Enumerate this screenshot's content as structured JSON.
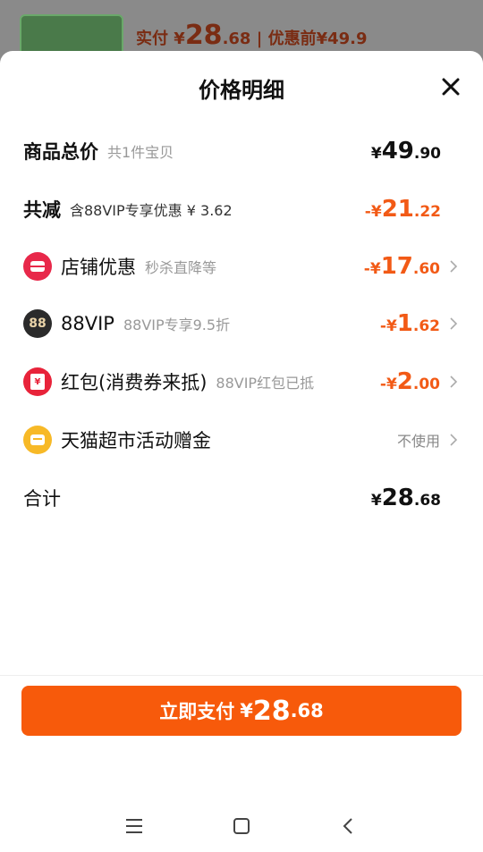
{
  "background": {
    "paid_label": "实付",
    "paid_currency": "¥",
    "paid_int": "28",
    "paid_dec": ".68",
    "separator": "|",
    "before_label": "优惠前",
    "before_value": "¥49.9"
  },
  "sheet": {
    "title": "价格明细",
    "rows": [
      {
        "label": "商品总价",
        "sub": "共1件宝贝",
        "amount_prefix": "¥",
        "amount_int": "49",
        "amount_dec": ".90"
      },
      {
        "label": "共减",
        "sub": "含88VIP专享优惠 ¥ 3.62",
        "amount_prefix": "-¥",
        "amount_int": "21",
        "amount_dec": ".22"
      },
      {
        "label": "店铺优惠",
        "sub": "秒杀直降等",
        "amount_prefix": "-¥",
        "amount_int": "17",
        "amount_dec": ".60"
      },
      {
        "label": "88VIP",
        "sub": "88VIP专享9.5折",
        "amount_prefix": "-¥",
        "amount_int": "1",
        "amount_dec": ".62"
      },
      {
        "label": "红包(消费券来抵)",
        "sub": "88VIP红包已抵",
        "amount_prefix": "-¥",
        "amount_int": "2",
        "amount_dec": ".00"
      },
      {
        "label": "天猫超市活动赠金",
        "sub": "",
        "amount_text": "不使用"
      },
      {
        "label": "合计",
        "sub": "",
        "amount_prefix": "¥",
        "amount_int": "28",
        "amount_dec": ".68"
      }
    ],
    "icon_labels": {
      "vip_icon": "88",
      "redpacket_icon": "¥"
    }
  },
  "pay_button": {
    "label": "立即支付",
    "currency": "¥",
    "int": "28",
    "dec": ".68"
  },
  "colors": {
    "accent": "#f75a0b",
    "discount": "#f25a16",
    "shop_icon": "#e8284a",
    "vip_icon": "#2b2b2b",
    "redpacket_icon": "#e8233a",
    "coin_icon": "#f7b927"
  },
  "icons": [
    "close-icon",
    "shop-icon",
    "vip-88-icon",
    "red-packet-icon",
    "coin-card-icon",
    "chevron-right-icon",
    "menu-icon",
    "home-icon",
    "back-icon"
  ]
}
